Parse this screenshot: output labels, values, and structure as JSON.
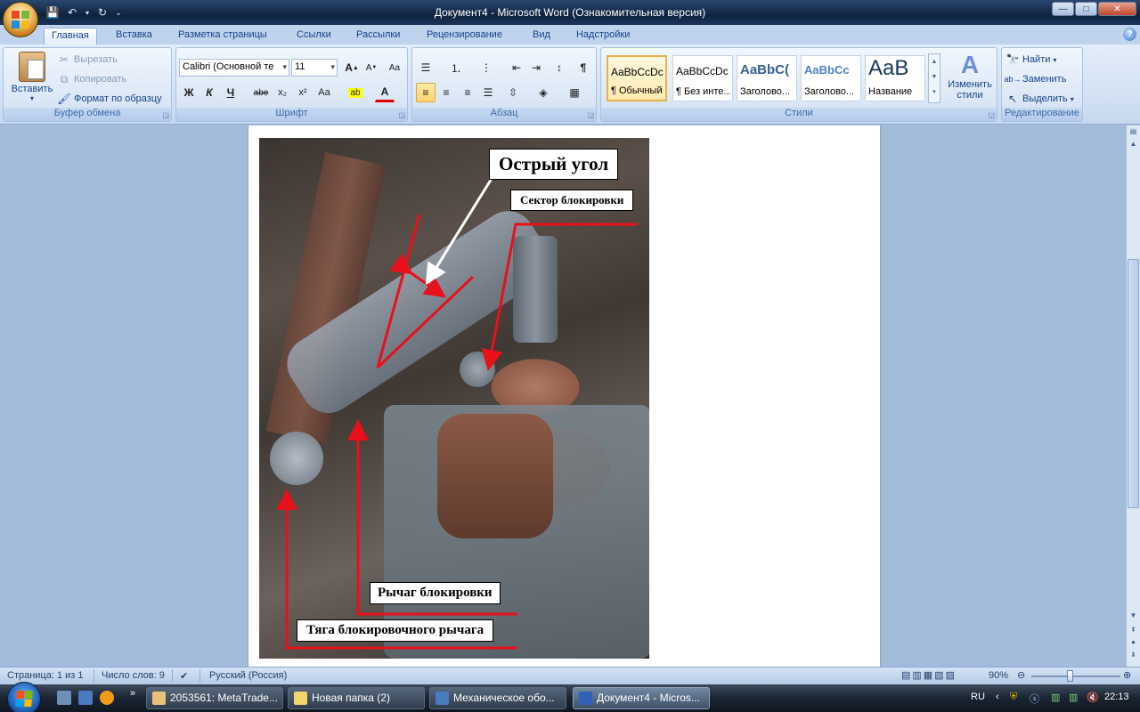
{
  "window": {
    "title": "Документ4 - Microsoft Word (Ознакомительная версия)",
    "controls": {
      "minimize": "—",
      "maximize": "□",
      "close": "✕"
    }
  },
  "quick_access": {
    "icons": [
      "save-icon",
      "undo-icon",
      "redo-icon",
      "customize-icon"
    ]
  },
  "ribbon_tabs": [
    "Главная",
    "Вставка",
    "Разметка страницы",
    "Ссылки",
    "Рассылки",
    "Рецензирование",
    "Вид",
    "Надстройки"
  ],
  "help": "?",
  "clipboard": {
    "paste": "Вставить",
    "cut": "Вырезать",
    "copy": "Копировать",
    "format_painter": "Формат по образцу",
    "label": "Буфер обмена"
  },
  "font": {
    "family": "Calibri (Основной те",
    "size": "11",
    "grow": "A",
    "shrink": "A",
    "clear": "Aa",
    "bold": "Ж",
    "italic": "К",
    "underline": "Ч",
    "strike": "abe",
    "subscript": "x₂",
    "superscript": "x²",
    "case": "Aa",
    "label": "Шрифт"
  },
  "paragraph": {
    "label": "Абзац",
    "marks": "¶"
  },
  "styles": {
    "items": [
      {
        "sample": "AaBbCcDc",
        "name": "¶ Обычный"
      },
      {
        "sample": "AaBbCcDc",
        "name": "¶ Без инте..."
      },
      {
        "sample": "AaBbC(",
        "name": "Заголово..."
      },
      {
        "sample": "AaBbCc",
        "name": "Заголово..."
      },
      {
        "sample": "AaB",
        "name": "Название"
      }
    ],
    "change": "Изменить стили",
    "label": "Стили"
  },
  "editing": {
    "find": "Найти",
    "replace": "Заменить",
    "select": "Выделить",
    "label": "Редактирование"
  },
  "document": {
    "callouts": {
      "angle": "Острый угол",
      "sector": "Сектор блокировки",
      "lever": "Рычаг блокировки",
      "rod": "Тяга блокировочного рычага"
    },
    "colors": {
      "arrow_red": "#e8101a",
      "arrow_white": "#ffffff"
    }
  },
  "status": {
    "page": "Страница: 1 из 1",
    "words": "Число слов: 9",
    "language": "Русский (Россия)",
    "zoom": "90%"
  },
  "taskbar": {
    "items": [
      {
        "label": "2053561: MetaTrade...",
        "active": false
      },
      {
        "label": "Новая папка (2)",
        "active": false
      },
      {
        "label": "Механическое обо...",
        "active": false
      },
      {
        "label": "Документ4 - Micros...",
        "active": true
      }
    ],
    "lang": "RU",
    "time": "22:13",
    "more": "»"
  }
}
